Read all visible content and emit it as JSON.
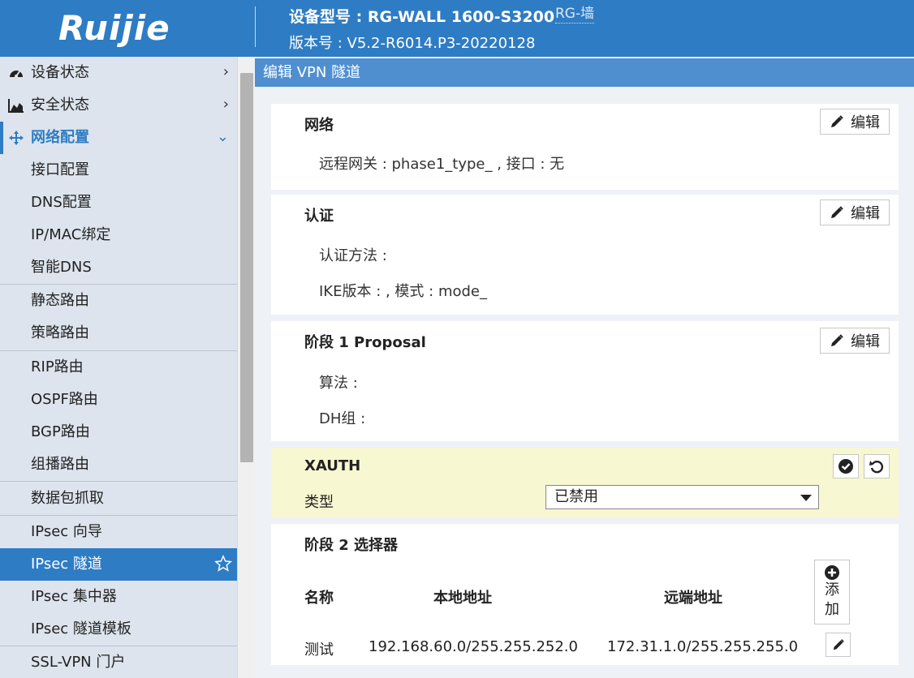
{
  "header": {
    "logo": "Ruijie",
    "model_label": "设备型号 : RG-WALL 1600-S3200",
    "model_tag": "RG-墙",
    "version_label": "版本号 : V5.2-R6014.P3-20220128"
  },
  "sidebar": {
    "items": [
      {
        "label": "设备状态",
        "icon": "dashboard-icon",
        "chevron": "›"
      },
      {
        "label": "安全状态",
        "icon": "area-chart-icon",
        "chevron": "›"
      },
      {
        "label": "网络配置",
        "icon": "move-arrows-icon",
        "chevron": "⌄"
      },
      {
        "label": "接口配置"
      },
      {
        "label": "DNS配置"
      },
      {
        "label": "IP/MAC绑定"
      },
      {
        "label": "智能DNS"
      },
      {
        "label": "静态路由"
      },
      {
        "label": "策略路由"
      },
      {
        "label": "RIP路由"
      },
      {
        "label": "OSPF路由"
      },
      {
        "label": "BGP路由"
      },
      {
        "label": "组播路由"
      },
      {
        "label": "数据包抓取"
      },
      {
        "label": "IPsec 向导"
      },
      {
        "label": "IPsec 隧道",
        "icon": "star-icon"
      },
      {
        "label": "IPsec 集中器"
      },
      {
        "label": "IPsec 隧道模板"
      },
      {
        "label": "SSL-VPN 门户"
      }
    ]
  },
  "main": {
    "title": "编辑 VPN 隧道",
    "network": {
      "title": "网络",
      "edit_label": "编辑",
      "line1": "远程网关 : phase1_type_ , 接口 : 无"
    },
    "auth": {
      "title": "认证",
      "edit_label": "编辑",
      "line1": "认证方法 :",
      "line2": "IKE版本 : , 模式 : mode_"
    },
    "phase1": {
      "title": "阶段 1 Proposal",
      "edit_label": "编辑",
      "line1": "算法 :",
      "line2": "DH组 :"
    },
    "xauth": {
      "title": "XAUTH",
      "type_label": "类型",
      "type_value": "已禁用"
    },
    "phase2": {
      "title": "阶段 2 选择器",
      "columns": [
        "名称",
        "本地地址",
        "远端地址"
      ],
      "add_label_1": "添",
      "add_label_2": "加",
      "rows": [
        {
          "name": "测试",
          "local": "192.168.60.0/255.255.252.0",
          "remote": "172.31.1.0/255.255.255.0"
        }
      ]
    }
  }
}
